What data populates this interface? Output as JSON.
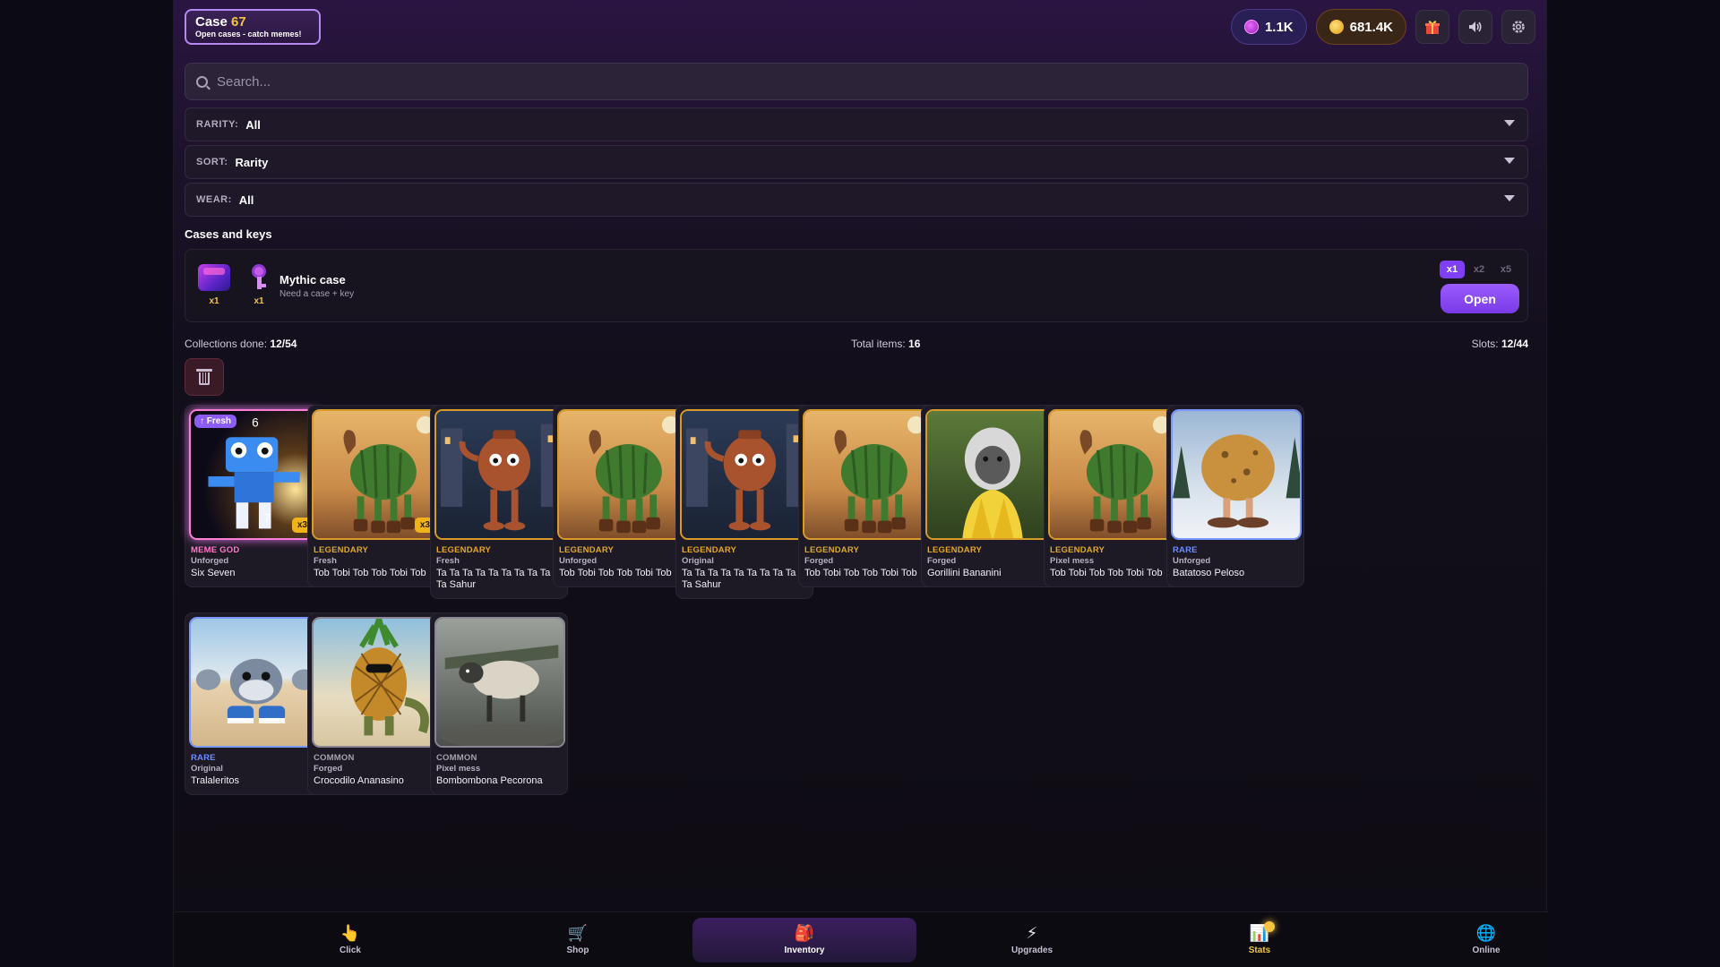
{
  "header": {
    "title_prefix": "Case",
    "title_number": "67",
    "subtitle": "Open cases - catch memes!",
    "gems": "1.1K",
    "coins": "681.4K",
    "gift_icon": "gift-icon",
    "sound_icon": "speaker-icon",
    "settings_icon": "gear-icon"
  },
  "search": {
    "placeholder": "Search..."
  },
  "filters": {
    "rarity": {
      "label": "RARITY:",
      "value": "All"
    },
    "sort": {
      "label": "SORT:",
      "value": "Rarity"
    },
    "wear": {
      "label": "WEAR:",
      "value": "All"
    }
  },
  "cases_section": {
    "title": "Cases and keys",
    "case_count": "x1",
    "key_count": "x1",
    "name": "Mythic case",
    "hint": "Need a case + key",
    "multipliers": [
      "x1",
      "x2",
      "x5"
    ],
    "open_label": "Open"
  },
  "stats": {
    "collections_label": "Collections done:",
    "collections_value": "12/54",
    "total_label": "Total items:",
    "total_value": "16",
    "slots_label": "Slots:",
    "slots_value": "12/44"
  },
  "colors": {
    "legendary": "#e0a82a",
    "rare": "#6d8cff",
    "common": "#a5a1ad",
    "meme_god": "#ff78c8",
    "accent": "#8c4df5"
  },
  "items": [
    {
      "rarity": "MEME GOD",
      "wear": "Unforged",
      "name": "Six Seven",
      "count": "x3",
      "fresh": "↑ Fresh",
      "kind": "mythic",
      "art": "blue-robot"
    },
    {
      "rarity": "LEGENDARY",
      "wear": "Fresh",
      "name": "Tob Tobi Tob Tob Tobi Tob",
      "count": "x3",
      "kind": "legendary",
      "art": "cactus-camel"
    },
    {
      "rarity": "LEGENDARY",
      "wear": "Fresh",
      "name": "Ta Ta Ta Ta Ta Ta Ta Ta Ta Ta Ta Sahur",
      "kind": "legendary",
      "art": "teapot"
    },
    {
      "rarity": "LEGENDARY",
      "wear": "Unforged",
      "name": "Tob Tobi Tob Tob Tobi Tob",
      "kind": "legendary",
      "art": "cactus-camel"
    },
    {
      "rarity": "LEGENDARY",
      "wear": "Original",
      "name": "Ta Ta Ta Ta Ta Ta Ta Ta Ta Ta Ta Sahur",
      "kind": "legendary",
      "art": "teapot"
    },
    {
      "rarity": "LEGENDARY",
      "wear": "Forged",
      "name": "Tob Tobi Tob Tob Tobi Tob",
      "kind": "legendary",
      "art": "cactus-camel"
    },
    {
      "rarity": "LEGENDARY",
      "wear": "Forged",
      "name": "Gorillini Bananini",
      "kind": "legendary",
      "art": "gorilla"
    },
    {
      "rarity": "LEGENDARY",
      "wear": "Pixel mess",
      "name": "Tob Tobi Tob Tob Tobi Tob",
      "kind": "legendary",
      "art": "cactus-camel"
    },
    {
      "rarity": "RARE",
      "wear": "Unforged",
      "name": "Batatoso Peloso",
      "kind": "rare",
      "art": "potato"
    },
    {
      "rarity": "RARE",
      "wear": "Original",
      "name": "Tralaleritos",
      "kind": "rare",
      "art": "shark-sneakers"
    },
    {
      "rarity": "COMMON",
      "wear": "Forged",
      "name": "Crocodilo Ananasino",
      "kind": "common",
      "art": "pineapple-croc"
    },
    {
      "rarity": "COMMON",
      "wear": "Pixel mess",
      "name": "Bombombona Pecorona",
      "kind": "common",
      "art": "sheep-plane"
    }
  ],
  "nav": [
    {
      "label": "Click",
      "icon": "pointer-hand-icon",
      "glyph": "👆"
    },
    {
      "label": "Shop",
      "icon": "cart-icon",
      "glyph": "🛒"
    },
    {
      "label": "Inventory",
      "icon": "backpack-icon",
      "glyph": "🎒"
    },
    {
      "label": "Upgrades",
      "icon": "lightning-icon",
      "glyph": "⚡"
    },
    {
      "label": "Stats",
      "icon": "bar-chart-icon",
      "glyph": "📊"
    },
    {
      "label": "Online",
      "icon": "globe-icon",
      "glyph": "🌐"
    }
  ]
}
